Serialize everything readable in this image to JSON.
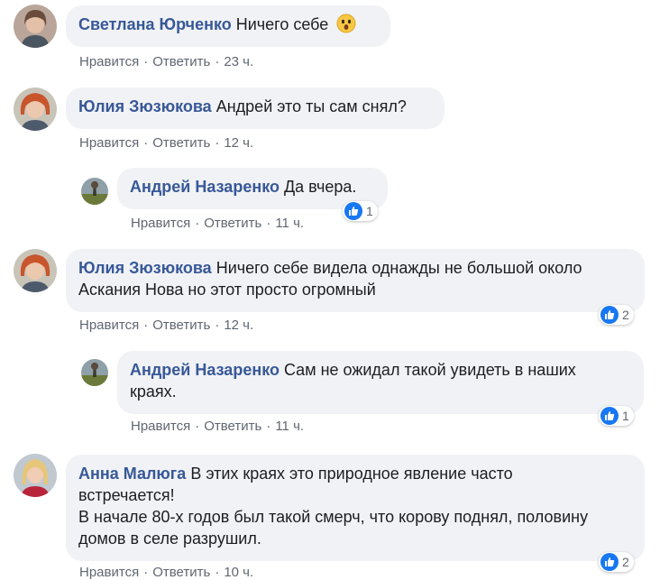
{
  "actions": {
    "like": "Нравится",
    "reply": "Ответить",
    "separator": "·"
  },
  "colors": {
    "author": "#385898",
    "bubble": "#f0f2f5",
    "meta": "#606770",
    "like": "#1877f2"
  },
  "comments": [
    {
      "author": "Светлана Юрченко",
      "text": "Ничего себе",
      "emoji": "astonished-face",
      "time": "23 ч.",
      "reactions": null
    },
    {
      "author": "Юлия Зюзюкова",
      "text": "Андрей это ты сам снял?",
      "time": "12 ч.",
      "reactions": null
    },
    {
      "author": "Андрей Назаренко",
      "text": "Да вчера.",
      "time": "11 ч.",
      "reactions": "1",
      "reply": true
    },
    {
      "author": "Юлия Зюзюкова",
      "text": "Ничего себе видела однажды не большой около\nАскания Нова но этот просто огромный",
      "time": "12 ч.",
      "reactions": "2"
    },
    {
      "author": "Андрей Назаренко",
      "text": "Сам не ожидал такой увидеть в наших\nкраях.",
      "time": "11 ч.",
      "reactions": "1",
      "reply": true
    },
    {
      "author": "Анна Малюга",
      "text": "В этих краях это природное явление часто\nвстречается!\nВ начале 80-х годов был такой смерч, что корову поднял, половину\nдомов в селе разрушил.",
      "time": "10 ч.",
      "reactions": "2"
    }
  ]
}
